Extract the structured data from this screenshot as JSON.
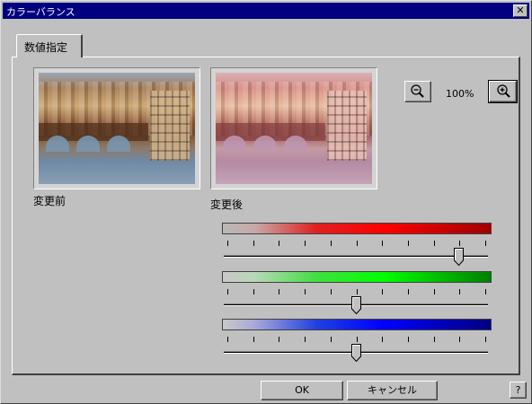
{
  "window": {
    "title": "カラーバランス",
    "close_label": "✕"
  },
  "tabs": [
    {
      "label": "数値指定"
    }
  ],
  "images": {
    "before_label": "変更前",
    "after_label": "変更後"
  },
  "zoom": {
    "level": "100%"
  },
  "sliders": [
    {
      "channel": "red",
      "color": "#ff0000",
      "position": 0.89
    },
    {
      "channel": "green",
      "color": "#00ff00",
      "position": 0.5
    },
    {
      "channel": "blue",
      "color": "#0000ff",
      "position": 0.5
    }
  ],
  "buttons": {
    "ok": "OK",
    "cancel": "キャンセル",
    "help": "?"
  },
  "tick_count": 11
}
